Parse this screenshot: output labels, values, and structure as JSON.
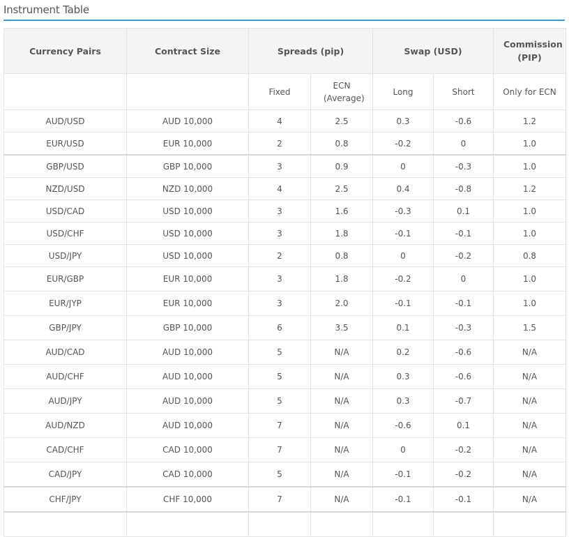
{
  "page": {
    "title": "Instrument Table"
  },
  "table": {
    "headers": [
      "Currency Pairs",
      "Contract Size",
      "Spreads (pip)",
      "Swap (USD)",
      "Commission (PIP)"
    ],
    "subheaders": [
      "",
      "",
      "Fixed",
      "ECN (Average)",
      "Long",
      "Short",
      "Only for ECN"
    ],
    "rows": [
      [
        "AUD/USD",
        "AUD 10,000",
        "4",
        "2.5",
        "0.3",
        "-0.6",
        "1.2"
      ],
      [
        "EUR/USD",
        "EUR 10,000",
        "2",
        "0.8",
        "-0.2",
        "0",
        "1.0"
      ],
      [
        "GBP/USD",
        "GBP 10,000",
        "3",
        "0.9",
        "0",
        "-0.3",
        "1.0"
      ],
      [
        "NZD/USD",
        "NZD 10,000",
        "4",
        "2.5",
        "0.4",
        "-0.8",
        "1.2"
      ],
      [
        "USD/CAD",
        "USD 10,000",
        "3",
        "1.6",
        "-0.3",
        "0.1",
        "1.0"
      ],
      [
        "USD/CHF",
        "USD 10,000",
        "3",
        "1.8",
        "-0.1",
        "-0.1",
        "1.0"
      ],
      [
        "USD/JPY",
        "USD 10,000",
        "2",
        "0.8",
        "0",
        "-0.2",
        "0.8"
      ],
      [
        "EUR/GBP",
        "EUR 10,000",
        "3",
        "1.8",
        "-0.2",
        "0",
        "1.0"
      ],
      [
        "EUR/JYP",
        "EUR 10,000",
        "3",
        "2.0",
        "-0.1",
        "-0.1",
        "1.0"
      ],
      [
        "GBP/JPY",
        "GBP 10,000",
        "6",
        "3.5",
        "0.1",
        "-0.3",
        "1.5"
      ],
      [
        "AUD/CAD",
        "AUD 10,000",
        "5",
        "N/A",
        "0.2",
        "-0.6",
        "N/A"
      ],
      [
        "AUD/CHF",
        "AUD 10,000",
        "5",
        "N/A",
        "0.3",
        "-0.6",
        "N/A"
      ],
      [
        "AUD/JPY",
        "AUD 10,000",
        "5",
        "N/A",
        "0.3",
        "-0.7",
        "N/A"
      ],
      [
        "AUD/NZD",
        "AUD 10,000",
        "7",
        "N/A",
        "-0.6",
        "0.1",
        "N/A"
      ],
      [
        "CAD/CHF",
        "CAD 10,000",
        "7",
        "N/A",
        "0",
        "-0.2",
        "N/A"
      ],
      [
        "CAD/JPY",
        "CAD 10,000",
        "5",
        "N/A",
        "-0.1",
        "-0.2",
        "N/A"
      ],
      [
        "CHF/JPY",
        "CHF 10,000",
        "7",
        "N/A",
        "-0.1",
        "-0.1",
        "N/A"
      ],
      [
        "",
        "",
        "",
        "",
        "",
        "",
        ""
      ]
    ]
  },
  "colors": {
    "accent_rule": "#35a4d8",
    "header_bg": "#f4f4f4",
    "border": "#e3e3e3",
    "text": "#555555"
  }
}
